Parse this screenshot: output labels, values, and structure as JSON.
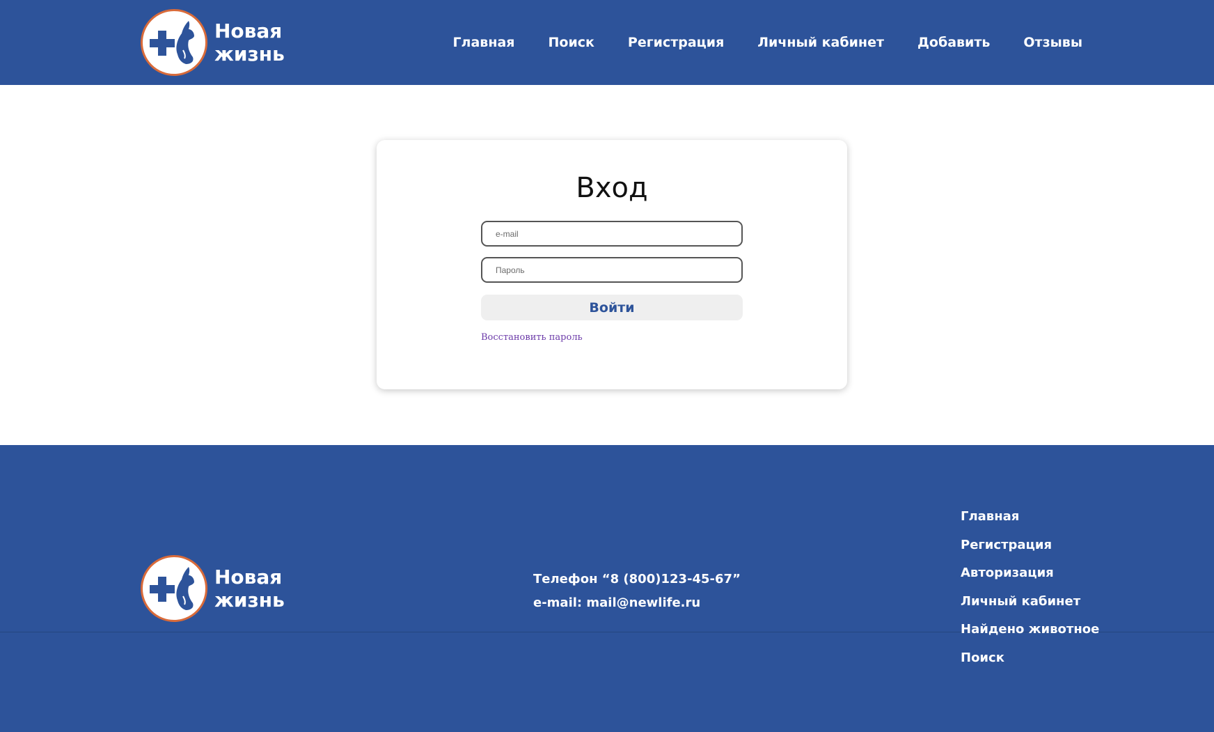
{
  "brand": {
    "name_line1": "Новая",
    "name_line2": "жизнь",
    "logo_icon": "medical-cross-pets-icon"
  },
  "header": {
    "nav": [
      {
        "label": "Главная"
      },
      {
        "label": "Поиск"
      },
      {
        "label": "Регистрация"
      },
      {
        "label": "Личный кабинет"
      },
      {
        "label": "Добавить"
      },
      {
        "label": "Отзывы"
      }
    ]
  },
  "login": {
    "title": "Вход",
    "email_placeholder": "e-mail",
    "password_placeholder": "Пароль",
    "submit_label": "Войти",
    "restore_link": "Восстановить пароль"
  },
  "footer": {
    "phone": "Телефон “8 (800)123-45-67”",
    "email": "e-mail: mail@newlife.ru",
    "nav": [
      {
        "label": "Главная"
      },
      {
        "label": "Регистрация"
      },
      {
        "label": "Авторизация"
      },
      {
        "label": "Личный кабинет"
      },
      {
        "label": "Найдено животное"
      },
      {
        "label": "Поиск"
      }
    ]
  },
  "colors": {
    "primary": "#2d539a",
    "logo_ring": "#d96b3a",
    "link_visited": "#6b3aa8",
    "button_bg": "#efefef"
  }
}
